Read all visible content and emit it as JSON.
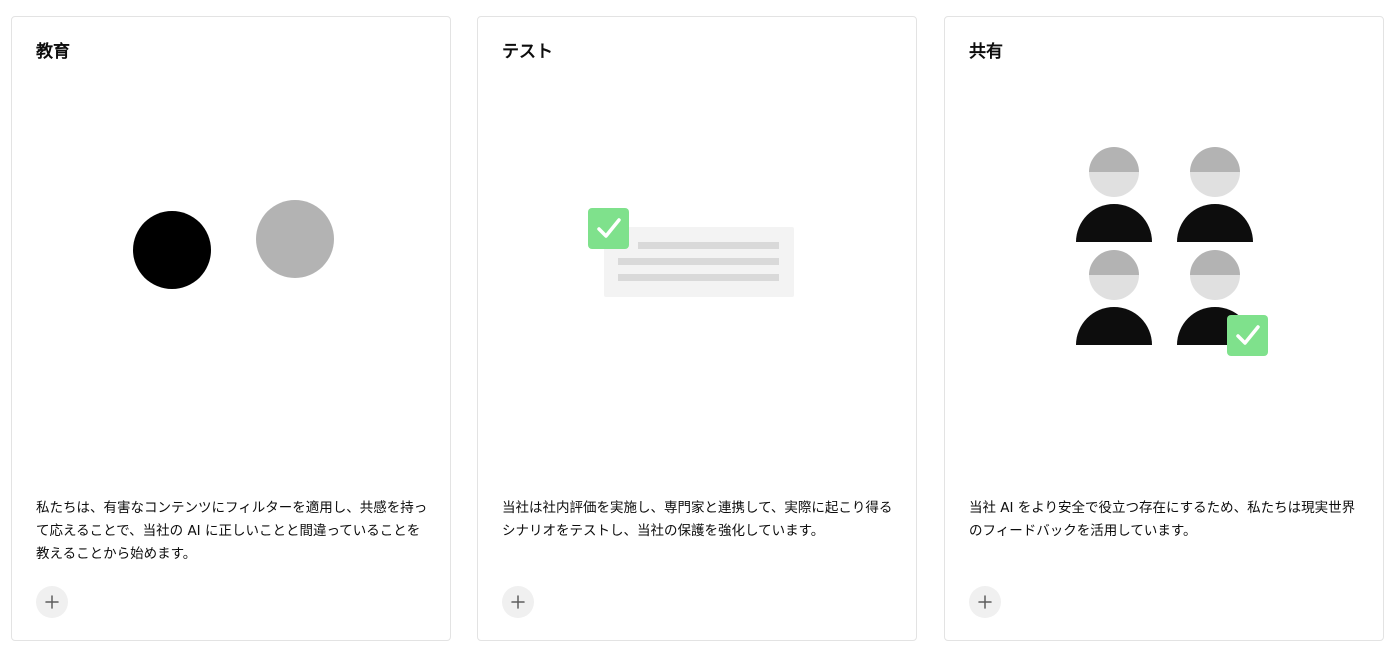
{
  "cards": [
    {
      "title": "教育",
      "description": "私たちは、有害なコンテンツにフィルターを適用し、共感を持って応えることで、当社の AI に正しいことと間違っていることを教えることから始めます。",
      "illustration": "two-circles",
      "expand_icon": "plus-icon"
    },
    {
      "title": "テスト",
      "description": "当社は社内評価を実施し、専門家と連携して、実際に起こり得るシナリオをテストし、当社の保護を強化しています。",
      "illustration": "checked-document",
      "expand_icon": "plus-icon"
    },
    {
      "title": "共有",
      "description": "当社 AI をより安全で役立つ存在にするため、私たちは現実世界のフィードバックを活用しています。",
      "illustration": "people-grid-check",
      "expand_icon": "plus-icon"
    }
  ],
  "colors": {
    "check_green": "#7fe18c",
    "dark": "#0d0d0d",
    "mid_gray": "#b3b3b3",
    "light_gray": "#e0e0e0",
    "panel_gray": "#f3f3f3",
    "line_gray": "#d9d9d9",
    "button_bg": "#f0f0f0"
  }
}
